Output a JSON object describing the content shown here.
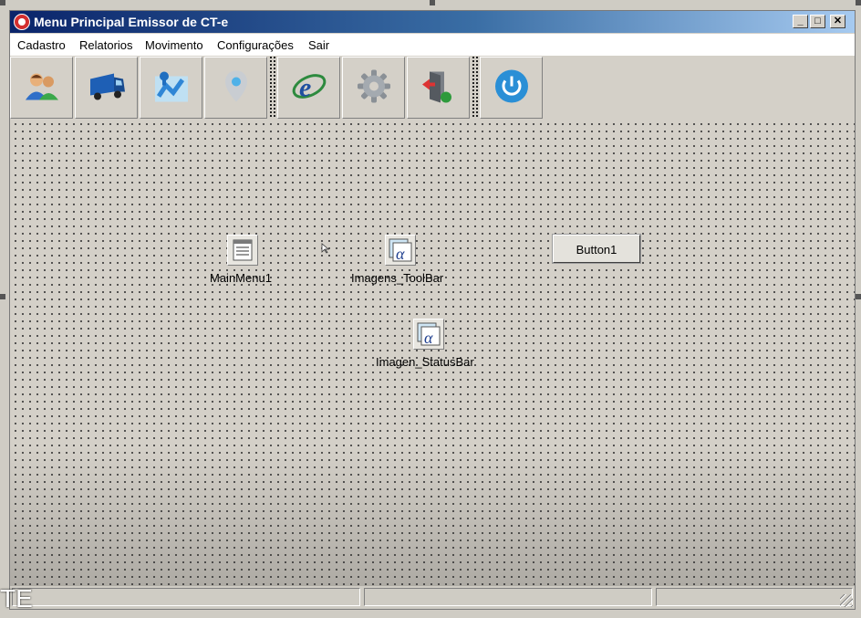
{
  "window": {
    "title": "Menu Principal Emissor de CT-e"
  },
  "window_controls": {
    "minimize": "_",
    "maximize": "□",
    "close": "✕"
  },
  "menu": {
    "items": [
      "Cadastro",
      "Relatorios",
      "Movimento",
      "Configurações",
      "Sair"
    ]
  },
  "toolbar": {
    "buttons": [
      {
        "icon": "users-icon"
      },
      {
        "icon": "truck-icon"
      },
      {
        "icon": "map-routes-icon"
      },
      {
        "icon": "location-pin-icon"
      },
      {
        "icon": "cte-e-icon"
      },
      {
        "icon": "gear-icon"
      },
      {
        "icon": "exit-door-icon"
      },
      {
        "icon": "power-icon"
      }
    ]
  },
  "components": {
    "main_menu": {
      "label": "MainMenu1"
    },
    "imagens_toolbar": {
      "label": "Imagens_ToolBar"
    },
    "imagen_statusbar": {
      "label": "Imagen_StatusBar"
    },
    "button1": {
      "label": "Button1"
    }
  },
  "overlay": {
    "text": "TE"
  },
  "colors": {
    "titlebar_start": "#0a246a",
    "titlebar_end": "#a6caf0",
    "form_background": "#d4d0c8"
  }
}
